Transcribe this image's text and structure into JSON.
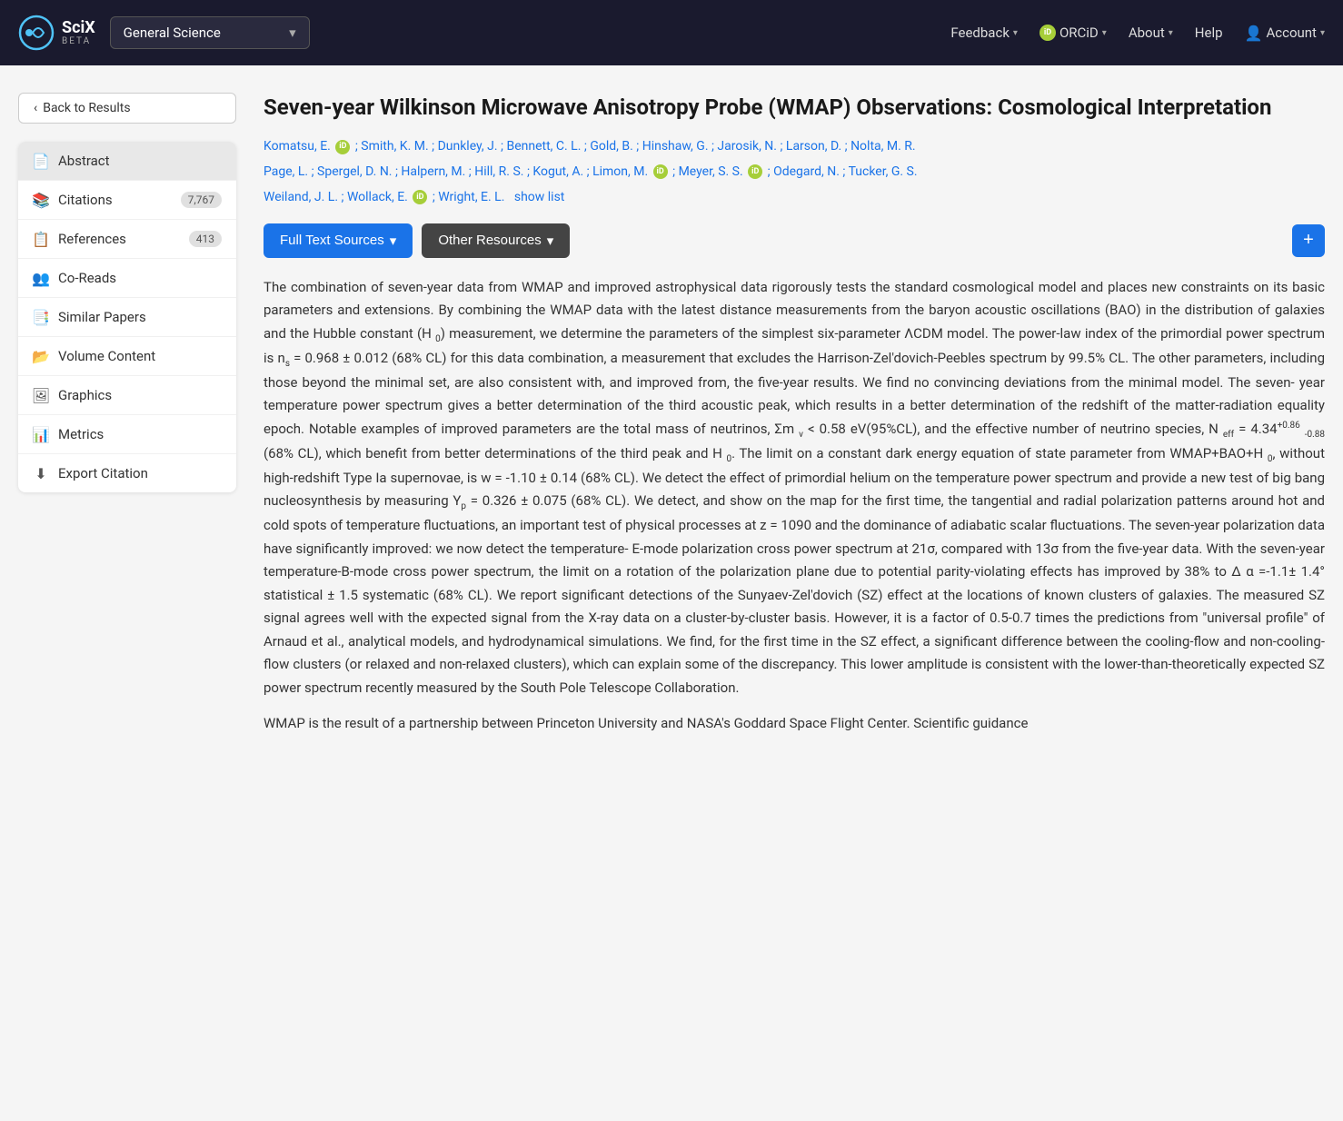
{
  "nav": {
    "logo_text": "SciX",
    "logo_beta": "BETA",
    "subject_select": "General Science",
    "feedback_label": "Feedback",
    "orcid_label": "ORCiD",
    "about_label": "About",
    "help_label": "Help",
    "account_label": "Account"
  },
  "back_button": "Back to Results",
  "sidebar": {
    "items": [
      {
        "id": "abstract",
        "label": "Abstract",
        "icon": "📄",
        "badge": null,
        "active": true
      },
      {
        "id": "citations",
        "label": "Citations",
        "icon": "📚",
        "badge": "7,767"
      },
      {
        "id": "references",
        "label": "References",
        "icon": "📋",
        "badge": "413"
      },
      {
        "id": "co-reads",
        "label": "Co-Reads",
        "icon": "👥",
        "badge": null
      },
      {
        "id": "similar-papers",
        "label": "Similar Papers",
        "icon": "📑",
        "badge": null
      },
      {
        "id": "volume-content",
        "label": "Volume Content",
        "icon": "📂",
        "badge": null
      },
      {
        "id": "graphics",
        "label": "Graphics",
        "icon": "🖼",
        "badge": null
      },
      {
        "id": "metrics",
        "label": "Metrics",
        "icon": "📊",
        "badge": null
      },
      {
        "id": "export-citation",
        "label": "Export Citation",
        "icon": "⬇",
        "badge": null
      }
    ]
  },
  "article": {
    "title": "Seven-year Wilkinson Microwave Anisotropy Probe (WMAP) Observations: Cosmological Interpretation",
    "authors": [
      {
        "name": "Komatsu, E.",
        "orcid": true
      },
      {
        "name": "Smith, K. M.",
        "orcid": false
      },
      {
        "name": "Dunkley, J.",
        "orcid": false
      },
      {
        "name": "Bennett, C. L.",
        "orcid": false
      },
      {
        "name": "Gold, B.",
        "orcid": false
      },
      {
        "name": "Hinshaw, G.",
        "orcid": false
      },
      {
        "name": "Jarosik, N.",
        "orcid": false
      },
      {
        "name": "Larson, D.",
        "orcid": false
      },
      {
        "name": "Nolta, M. R.",
        "orcid": false
      },
      {
        "name": "Page, L.",
        "orcid": false
      },
      {
        "name": "Spergel, D. N.",
        "orcid": false
      },
      {
        "name": "Halpern, M.",
        "orcid": false
      },
      {
        "name": "Hill, R. S.",
        "orcid": false
      },
      {
        "name": "Kogut, A.",
        "orcid": false
      },
      {
        "name": "Limon, M.",
        "orcid": true
      },
      {
        "name": "Meyer, S. S.",
        "orcid": true
      },
      {
        "name": "Odegard, N.",
        "orcid": false
      },
      {
        "name": "Tucker, G. S.",
        "orcid": false
      },
      {
        "name": "Weiland, J. L.",
        "orcid": false
      },
      {
        "name": "Wollack, E.",
        "orcid": true
      },
      {
        "name": "Wright, E. L.",
        "orcid": false
      }
    ],
    "show_list": "show list",
    "full_text_label": "Full Text Sources",
    "other_resources_label": "Other Resources",
    "add_label": "+",
    "abstract": "The combination of seven-year data from WMAP and improved astrophysical data rigorously tests the standard cosmological model and places new constraints on its basic parameters and extensions. By combining the WMAP data with the latest distance measurements from the baryon acoustic oscillations (BAO) in the distribution of galaxies and the Hubble constant (H₀) measurement, we determine the parameters of the simplest six-parameter ΛCDM model. The power-law index of the primordial power spectrum is n_s = 0.968 ± 0.012 (68% CL) for this data combination, a measurement that excludes the Harrison-Zel'dovich-Peebles spectrum by 99.5% CL. The other parameters, including those beyond the minimal set, are also consistent with, and improved from, the five-year results. We find no convincing deviations from the minimal model. The seven-year temperature power spectrum gives a better determination of the third acoustic peak, which results in a better determination of the redshift of the matter-radiation equality epoch. Notable examples of improved parameters are the total mass of neutrinos, Σm_ν < 0.58 eV(95%CL), and the effective number of neutrino species, N_eff = 4.34 (68% CL), which benefit from better determinations of the third peak and H₀. The limit on a constant dark energy equation of state parameter from WMAP+BAO+H₀, without high-redshift Type Ia supernovae, is w = -1.10 ± 0.14 (68% CL). We detect the effect of primordial helium on the temperature power spectrum and provide a new test of big bang nucleosynthesis by measuring Y_p = 0.326 ± 0.075 (68% CL). We detect, and show on the map for the first time, the tangential and radial polarization patterns around hot and cold spots of temperature fluctuations, an important test of physical processes at z = 1090 and the dominance of adiabatic scalar fluctuations. The seven-year polarization data have significantly improved: we now detect the temperature-E-mode polarization cross power spectrum at 21σ, compared with 13σ from the five-year data. With the seven-year temperature-B-mode cross power spectrum, the limit on a rotation of the polarization plane due to potential parity-violating effects has improved by 38% to Δ α = -1.1 ± 1.4° statistical ± 1.5 systematic (68% CL). We report significant detections of the Sunyaev-Zel'dovich (SZ) effect at the locations of known clusters of galaxies. The measured SZ signal agrees well with the expected signal from the X-ray data on a cluster-by-cluster basis. However, it is a factor of 0.5-0.7 times the predictions from \"universal profile\" of Arnaud et al., analytical models, and hydrodynamical simulations. We find, for the first time in the SZ effect, a significant difference between the cooling-flow and non-cooling-flow clusters (or relaxed and non-relaxed clusters), which can explain some of the discrepancy. This lower amplitude is consistent with the lower-than-theoretically expected SZ power spectrum recently measured by the South Pole Telescope Collaboration.",
    "abstract_continued": "WMAP is the result of a partnership between Princeton University and NASA's Goddard Space Flight Center. Scientific guidance"
  }
}
